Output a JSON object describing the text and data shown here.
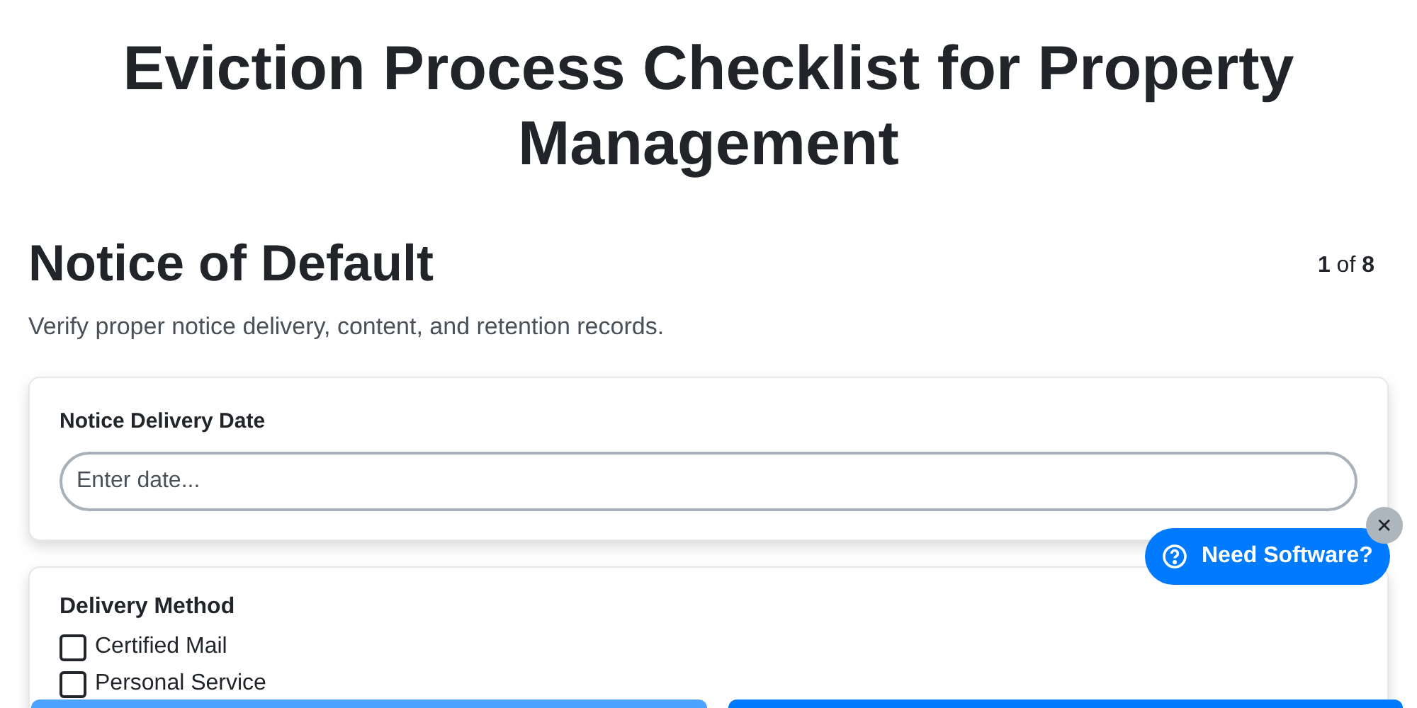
{
  "title": "Eviction Process Checklist for Property Management",
  "section": {
    "heading": "Notice of Default",
    "counter": "**1** of **8**",
    "description": "Verify proper notice delivery, content, and retention records."
  },
  "fields": [
    {
      "label": "Notice Delivery Date",
      "placeholder": "Enter date..."
    }
  ],
  "checkbox_groups": [
    {
      "label": "Delivery Method",
      "options": [
        {
          "label": "Certified Mail",
          "checked": false
        },
        {
          "label": "Personal Service",
          "checked": false
        }
      ]
    }
  ],
  "help_widget": {
    "label": "Need Software?",
    "close": "✕"
  },
  "footer_buttons": [
    {
      "kind": "secondary"
    },
    {
      "kind": "primary"
    }
  ]
}
